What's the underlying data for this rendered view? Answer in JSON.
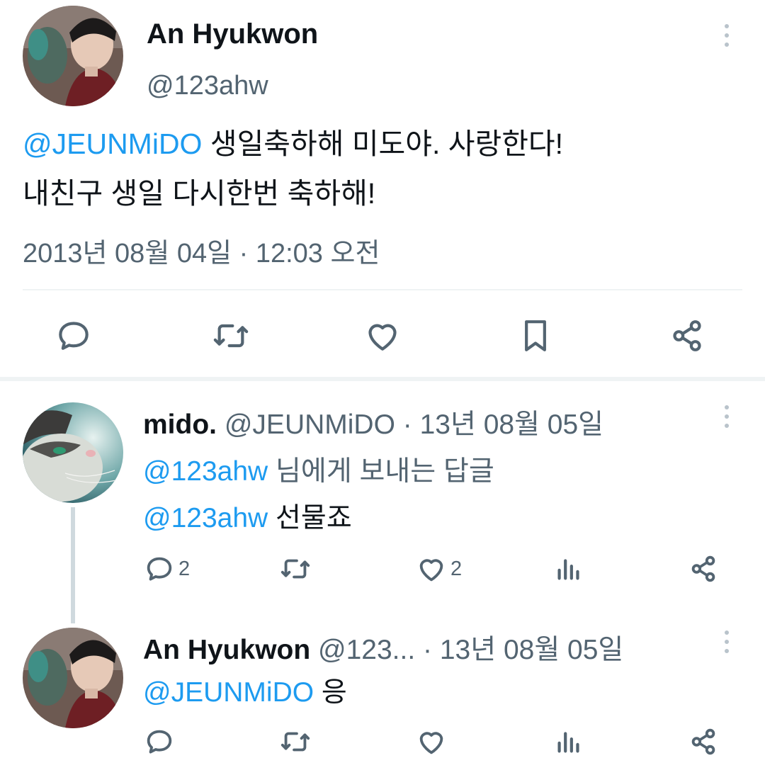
{
  "main_tweet": {
    "author_name": "An Hyukwon",
    "handle": "@123ahw",
    "mention": "@JEUNMiDO",
    "text_line1": " 생일축하해 미도야. 사랑한다!",
    "text_line2": "내친구 생일 다시한번 축하해!",
    "timestamp": "2013년 08월 04일 · 12:03 오전"
  },
  "replies": [
    {
      "author_name": "mido.",
      "handle": "@JEUNMiDO",
      "date": " · 13년 08월 05일",
      "reply_to_mention": "@123ahw",
      "reply_to_text": " 님에게 보내는 답글",
      "body_mention": "@123ahw",
      "body_text": " 선물죠",
      "reply_count": "2",
      "like_count": "2"
    },
    {
      "author_name": "An Hyukwon",
      "handle": "@123...",
      "date": " · 13년 08월 05일",
      "body_mention": "@JEUNMiDO",
      "body_text": " 응"
    }
  ],
  "colors": {
    "link": "#1d9bf0",
    "secondary_text": "#536471",
    "primary_text": "#0f1419",
    "divider": "#eff3f4"
  },
  "icons": [
    "more-icon",
    "reply-icon",
    "retweet-icon",
    "like-icon",
    "bookmark-icon",
    "share-icon",
    "views-icon"
  ]
}
